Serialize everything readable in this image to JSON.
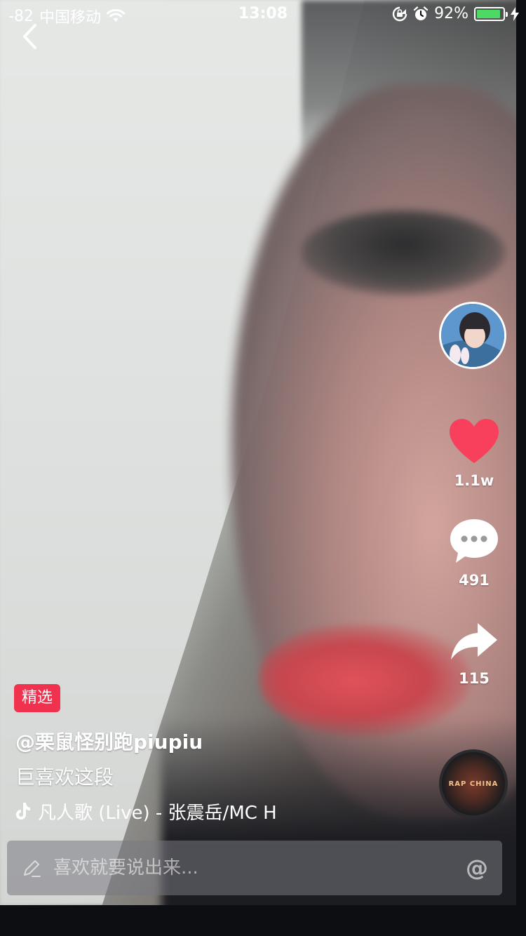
{
  "status_bar": {
    "signal": "-82",
    "carrier": "中国移动",
    "time": "13:08",
    "battery_percent_text": "92%",
    "battery_level": 0.92,
    "battery_color": "#4cd964"
  },
  "post": {
    "tag": "精选",
    "tag_color": "#f0324e",
    "author": "@栗鼠怪别跑piupiu",
    "caption": "巨喜欢这段",
    "music": "凡人歌 (Live) - 张震岳/MC H"
  },
  "actions": {
    "like_count": "1.1w",
    "comment_count": "491",
    "share_count": "115",
    "like_color": "#f83f5c"
  },
  "music_disc": {
    "label": "RAP CHINA"
  },
  "comment_input": {
    "placeholder": "喜欢就要说出来..."
  },
  "icons": {
    "back": "chevron-left-icon",
    "wifi": "wifi-icon",
    "lock": "rotation-lock-icon",
    "alarm": "alarm-icon",
    "charging": "bolt-icon",
    "like": "heart-icon",
    "comment": "speech-bubble-icon",
    "share": "share-arrow-icon",
    "music_note": "tiktok-note-icon",
    "edit": "pencil-icon",
    "mention": "at-icon"
  }
}
